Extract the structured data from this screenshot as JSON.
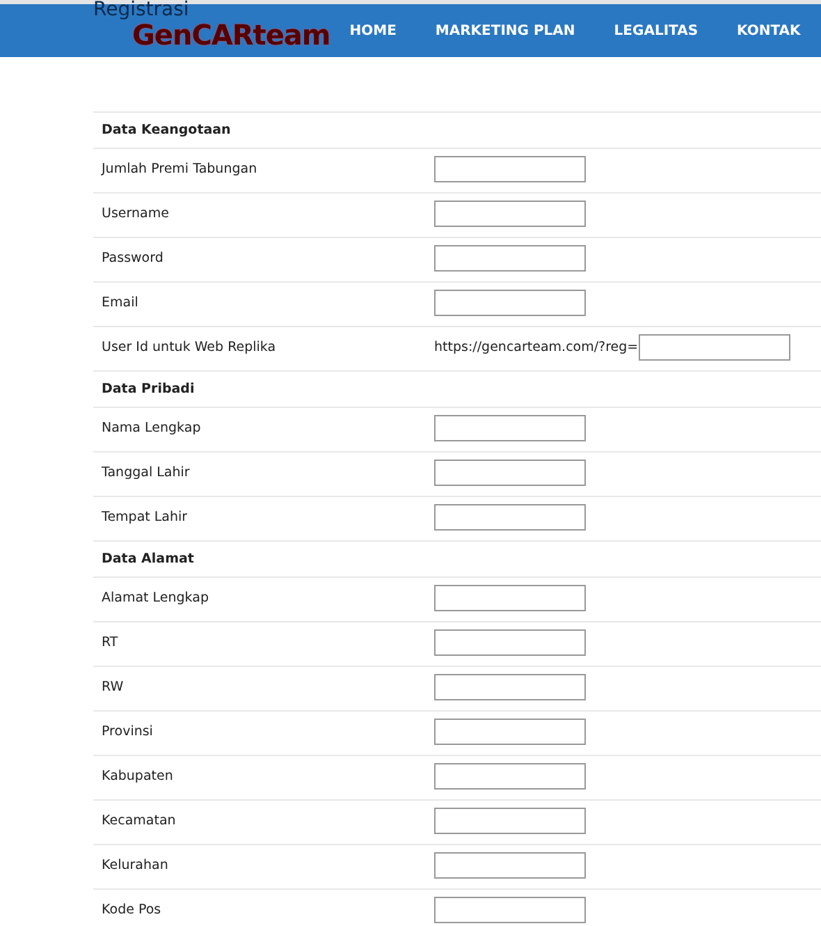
{
  "page_title": "Registrasi",
  "header": {
    "logo": "GenCARteam",
    "nav": [
      "HOME",
      "MARKETING PLAN",
      "LEGALITAS",
      "KONTAK"
    ]
  },
  "sections": [
    {
      "title": "Data Keangotaan",
      "fields": [
        {
          "label": "Jumlah Premi Tabungan",
          "kind": "text"
        },
        {
          "label": "Username",
          "kind": "text"
        },
        {
          "label": "Password",
          "kind": "text"
        },
        {
          "label": "Email",
          "kind": "text"
        },
        {
          "label": "User Id untuk Web Replika",
          "kind": "prefixed",
          "prefix": "https://gencarteam.com/?reg="
        }
      ]
    },
    {
      "title": "Data Pribadi",
      "fields": [
        {
          "label": "Nama Lengkap",
          "kind": "text"
        },
        {
          "label": "Tanggal Lahir",
          "kind": "text"
        },
        {
          "label": "Tempat Lahir",
          "kind": "text"
        }
      ]
    },
    {
      "title": "Data Alamat",
      "fields": [
        {
          "label": "Alamat Lengkap",
          "kind": "text"
        },
        {
          "label": "RT",
          "kind": "text"
        },
        {
          "label": "RW",
          "kind": "text"
        },
        {
          "label": "Provinsi",
          "kind": "text"
        },
        {
          "label": "Kabupaten",
          "kind": "text"
        },
        {
          "label": "Kecamatan",
          "kind": "text"
        },
        {
          "label": "Kelurahan",
          "kind": "text"
        },
        {
          "label": "Kode Pos",
          "kind": "text"
        }
      ]
    }
  ]
}
